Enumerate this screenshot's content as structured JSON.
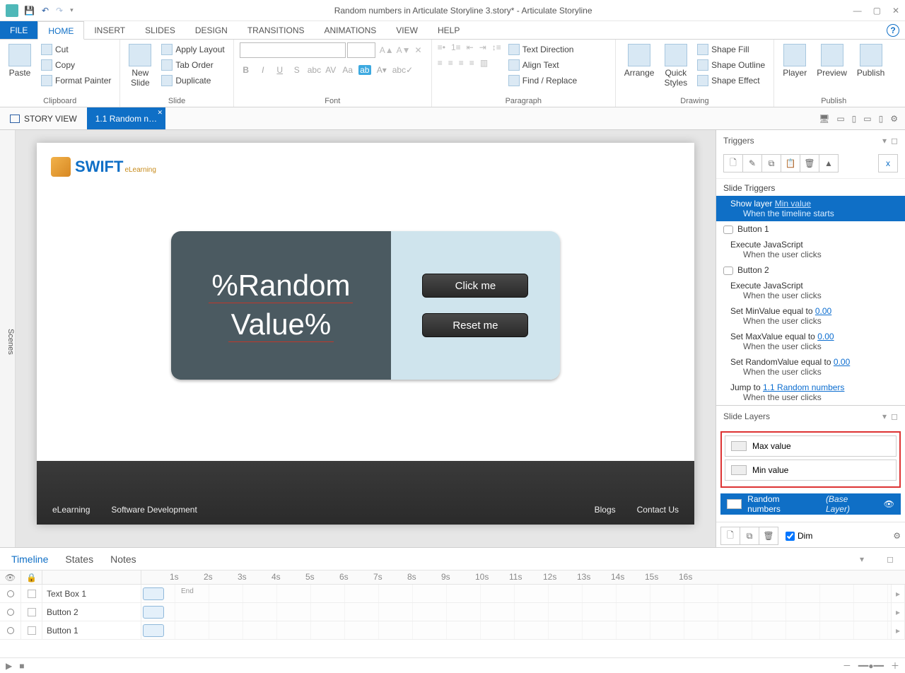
{
  "titlebar": {
    "title": "Random numbers in Articulate Storyline 3.story* - Articulate Storyline"
  },
  "ribbonTabs": {
    "file": "FILE",
    "home": "HOME",
    "insert": "INSERT",
    "slides": "SLIDES",
    "design": "DESIGN",
    "transitions": "TRANSITIONS",
    "animations": "ANIMATIONS",
    "view": "VIEW",
    "help": "HELP"
  },
  "ribbon": {
    "clipboard": {
      "paste": "Paste",
      "cut": "Cut",
      "copy": "Copy",
      "formatPainter": "Format Painter",
      "label": "Clipboard"
    },
    "slide": {
      "newSlide": "New\nSlide",
      "applyLayout": "Apply Layout",
      "tabOrder": "Tab Order",
      "duplicate": "Duplicate",
      "label": "Slide"
    },
    "font": {
      "label": "Font"
    },
    "paragraph": {
      "textDirection": "Text Direction",
      "alignText": "Align Text",
      "findReplace": "Find / Replace",
      "label": "Paragraph"
    },
    "drawing": {
      "arrange": "Arrange",
      "quickStyles": "Quick\nStyles",
      "shapeFill": "Shape Fill",
      "shapeOutline": "Shape Outline",
      "shapeEffect": "Shape Effect",
      "label": "Drawing"
    },
    "publish": {
      "player": "Player",
      "preview": "Preview",
      "publish": "Publish",
      "label": "Publish"
    }
  },
  "viewbar": {
    "storyView": "STORY VIEW",
    "tab": "1.1 Random n…"
  },
  "scenesRail": "Scenes",
  "slide": {
    "brand": "SWIFT",
    "brandSmall": "eLearning",
    "varLine1": "%Random",
    "varLine2": "Value%",
    "btn1": "Click me",
    "btn2": "Reset me",
    "footer": {
      "a": "eLearning",
      "b": "Software Development",
      "c": "Blogs",
      "d": "Contact Us"
    }
  },
  "triggersPanel": {
    "title": "Triggers",
    "sect": "Slide Triggers",
    "t1": {
      "text": "Show layer",
      "link": "Min value",
      "sub": "When the timeline starts"
    },
    "h1": "Button 1",
    "t2": {
      "text": "Execute JavaScript",
      "sub": "When the user clicks"
    },
    "h2": "Button 2",
    "t3": {
      "text": "Execute JavaScript",
      "sub": "When the user clicks"
    },
    "t4": {
      "text": "Set MinValue equal to",
      "link": "0.00",
      "sub": "When the user clicks"
    },
    "t5": {
      "text": "Set MaxValue equal to",
      "link": "0.00",
      "sub": "When the user clicks"
    },
    "t6": {
      "text": "Set RandomValue equal to",
      "link": "0.00",
      "sub": "When the user clicks"
    },
    "t7": {
      "text": "Jump to",
      "link": "1.1 Random numbers",
      "sub": "When the user clicks"
    }
  },
  "layersPanel": {
    "title": "Slide Layers",
    "l1": "Max value",
    "l2": "Min value",
    "base": "Random numbers",
    "baseTag": "(Base Layer)",
    "dim": "Dim"
  },
  "timeline": {
    "tabs": {
      "timeline": "Timeline",
      "states": "States",
      "notes": "Notes"
    },
    "ticks": [
      "1s",
      "2s",
      "3s",
      "4s",
      "5s",
      "6s",
      "7s",
      "8s",
      "9s",
      "10s",
      "11s",
      "12s",
      "13s",
      "14s",
      "15s",
      "16s"
    ],
    "end": "End",
    "rows": [
      "Text Box 1",
      "Button 2",
      "Button 1"
    ]
  }
}
